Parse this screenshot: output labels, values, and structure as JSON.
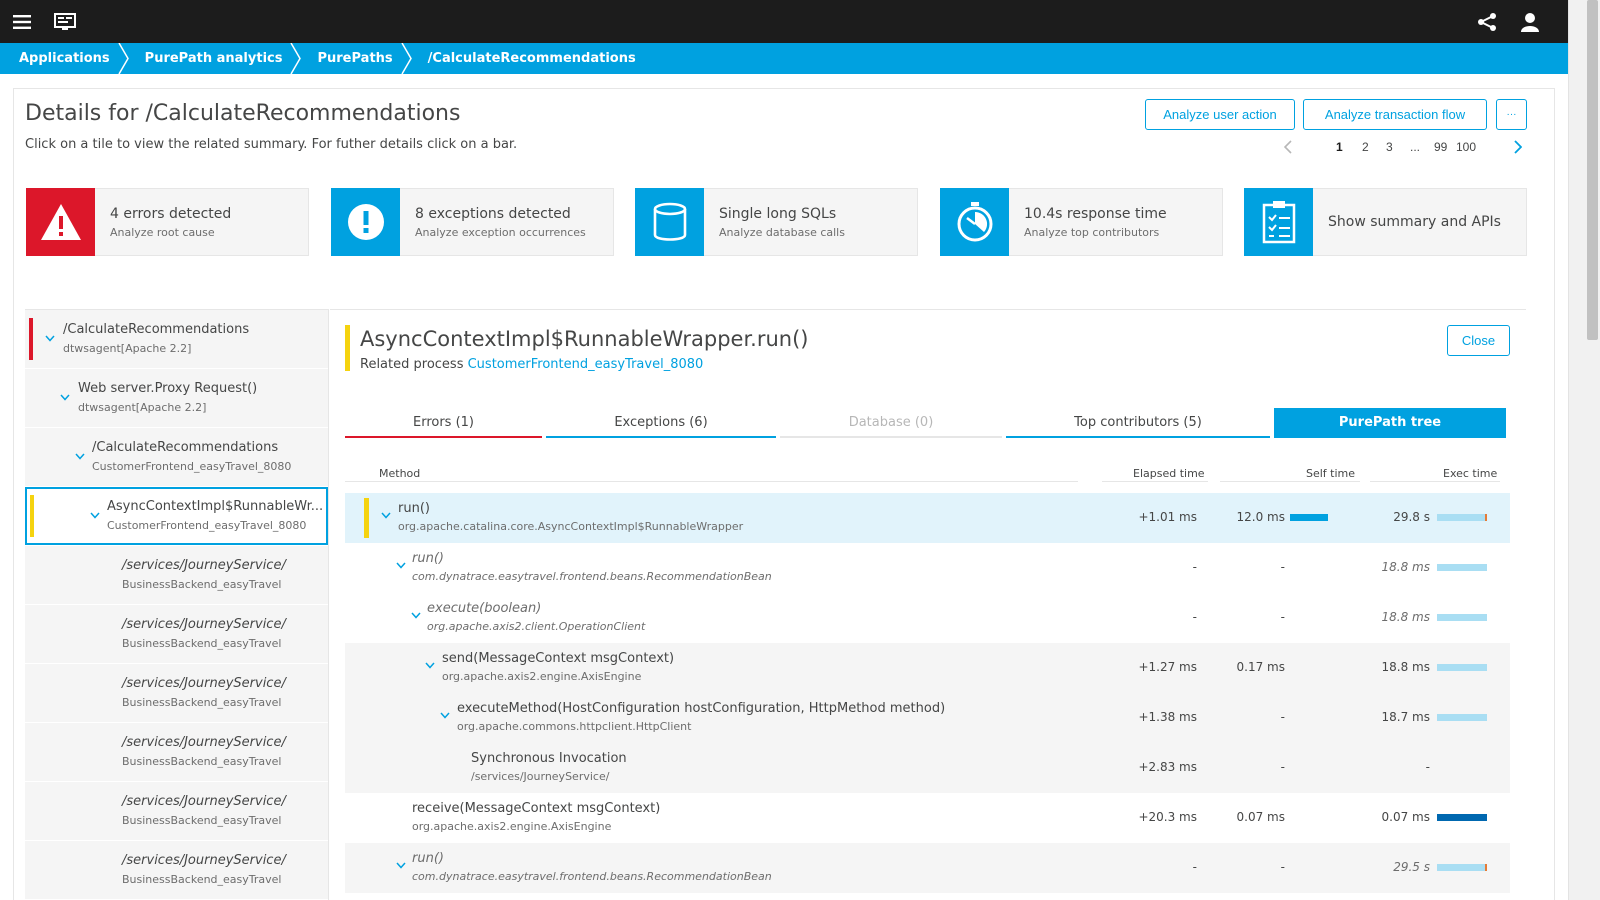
{
  "topbar": {
    "menu_icon": "menu-icon",
    "monitor_icon": "monitor-icon",
    "share_icon": "share-icon",
    "user_icon": "user-icon"
  },
  "breadcrumb": [
    "Applications",
    "PurePath analytics",
    "PurePaths",
    "/CalculateRecommendations"
  ],
  "header": {
    "title": "Details for /CalculateRecommendations",
    "subtitle": "Click on a tile to view the related summary. For futher details click on a bar.",
    "analyze_user_action": "Analyze user action",
    "analyze_transaction_flow": "Analyze transaction flow",
    "more": "···"
  },
  "pager": {
    "pages": [
      "1",
      "2",
      "3",
      "...",
      "99",
      "100"
    ],
    "current": "1"
  },
  "tiles": [
    {
      "title": "4 errors detected",
      "sub": "Analyze root cause",
      "icon": "warning-icon",
      "color": "#dc172a"
    },
    {
      "title": "8 exceptions detected",
      "sub": "Analyze exception occurrences",
      "icon": "exclamation-icon",
      "color": "#00a1e0"
    },
    {
      "title": "Single long SQLs",
      "sub": "Analyze database calls",
      "icon": "database-icon",
      "color": "#00a1e0"
    },
    {
      "title": "10.4s response time",
      "sub": "Analyze top contributors",
      "icon": "stopwatch-icon",
      "color": "#00a1e0"
    },
    {
      "title": "Show summary and APIs",
      "sub": "",
      "icon": "clipboard-icon",
      "color": "#00a1e0"
    }
  ],
  "tree": [
    {
      "label": "/CalculateRecommendations",
      "sub": "dtwsagent[Apache 2.2]"
    },
    {
      "label": "Web server.Proxy Request()",
      "sub": "dtwsagent[Apache 2.2]"
    },
    {
      "label": "/CalculateRecommendations",
      "sub": "CustomerFrontend_easyTravel_8080"
    },
    {
      "label": "AsyncContextImpl$RunnableWr...",
      "sub": "CustomerFrontend_easyTravel_8080"
    },
    {
      "label": "/services/JourneyService/",
      "sub": "BusinessBackend_easyTravel"
    },
    {
      "label": "/services/JourneyService/",
      "sub": "BusinessBackend_easyTravel"
    },
    {
      "label": "/services/JourneyService/",
      "sub": "BusinessBackend_easyTravel"
    },
    {
      "label": "/services/JourneyService/",
      "sub": "BusinessBackend_easyTravel"
    },
    {
      "label": "/services/JourneyService/",
      "sub": "BusinessBackend_easyTravel"
    },
    {
      "label": "/services/JourneyService/",
      "sub": "BusinessBackend_easyTravel"
    }
  ],
  "detail": {
    "title": "AsyncContextImpl$RunnableWrapper.run()",
    "related_label": "Related process",
    "related_link": "CustomerFrontend_easyTravel_8080",
    "close": "Close",
    "tabs": [
      "Errors (1)",
      "Exceptions (6)",
      "Database (0)",
      "Top contributors (5)",
      "PurePath tree"
    ],
    "columns": {
      "method": "Method",
      "elapsed": "Elapsed time",
      "self": "Self time",
      "exec": "Exec time"
    },
    "rows": [
      {
        "method": "run()",
        "class": "org.apache.catalina.core.AsyncContextImpl$RunnableWrapper",
        "elapsed": "+1.01 ms",
        "self": "12.0 ms",
        "exec": "29.8 s"
      },
      {
        "method": "run()",
        "class": "com.dynatrace.easytravel.frontend.beans.RecommendationBean",
        "elapsed": "-",
        "self": "-",
        "exec": "18.8 ms"
      },
      {
        "method": "execute(boolean)",
        "class": "org.apache.axis2.client.OperationClient",
        "elapsed": "-",
        "self": "-",
        "exec": "18.8 ms"
      },
      {
        "method": "send(MessageContext msgContext)",
        "class": "org.apache.axis2.engine.AxisEngine",
        "elapsed": "+1.27 ms",
        "self": "0.17 ms",
        "exec": "18.8 ms"
      },
      {
        "method": "executeMethod(HostConfiguration hostConfiguration, HttpMethod method)",
        "class": "org.apache.commons.httpclient.HttpClient",
        "elapsed": "+1.38 ms",
        "self": "-",
        "exec": "18.7 ms"
      },
      {
        "method": "Synchronous Invocation",
        "class": "/services/JourneyService/",
        "elapsed": "+2.83 ms",
        "self": "-",
        "exec": "-"
      },
      {
        "method": "receive(MessageContext msgContext)",
        "class": "org.apache.axis2.engine.AxisEngine",
        "elapsed": "+20.3 ms",
        "self": "0.07 ms",
        "exec": "0.07 ms"
      },
      {
        "method": "run()",
        "class": "com.dynatrace.easytravel.frontend.beans.RecommendationBean",
        "elapsed": "-",
        "self": "-",
        "exec": "29.5 s"
      }
    ]
  },
  "colors": {
    "accent": "#00a1e0",
    "error": "#dc172a",
    "warning": "#f5d30f",
    "bar_light": "#a9def3",
    "bar_dark": "#0068b0",
    "bar_tick": "#e57b37"
  }
}
